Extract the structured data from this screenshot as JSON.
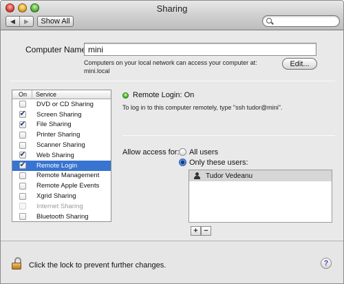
{
  "window": {
    "title": "Sharing"
  },
  "toolbar": {
    "back": "◀",
    "forward": "▶",
    "show_all": "Show All",
    "search_placeholder": ""
  },
  "computer_name": {
    "label": "Computer Name:",
    "value": "mini",
    "description_line1": "Computers on your local network can access your computer at:",
    "description_line2": "mini.local",
    "edit_button": "Edit..."
  },
  "services": {
    "header_on": "On",
    "header_service": "Service",
    "items": [
      {
        "name": "DVD or CD Sharing",
        "on": false,
        "selected": false,
        "disabled": false
      },
      {
        "name": "Screen Sharing",
        "on": true,
        "selected": false,
        "disabled": false
      },
      {
        "name": "File Sharing",
        "on": true,
        "selected": false,
        "disabled": false
      },
      {
        "name": "Printer Sharing",
        "on": false,
        "selected": false,
        "disabled": false
      },
      {
        "name": "Scanner Sharing",
        "on": false,
        "selected": false,
        "disabled": false
      },
      {
        "name": "Web Sharing",
        "on": true,
        "selected": false,
        "disabled": false
      },
      {
        "name": "Remote Login",
        "on": true,
        "selected": true,
        "disabled": false
      },
      {
        "name": "Remote Management",
        "on": false,
        "selected": false,
        "disabled": false
      },
      {
        "name": "Remote Apple Events",
        "on": false,
        "selected": false,
        "disabled": false
      },
      {
        "name": "Xgrid Sharing",
        "on": false,
        "selected": false,
        "disabled": false
      },
      {
        "name": "Internet Sharing",
        "on": false,
        "selected": false,
        "disabled": true
      },
      {
        "name": "Bluetooth Sharing",
        "on": false,
        "selected": false,
        "disabled": false
      }
    ]
  },
  "detail": {
    "status": "Remote Login: On",
    "status_color": "#49b52c",
    "info": "To log in to this computer remotely, type \"ssh tudor@mini\".",
    "allow_label": "Allow access for:",
    "option_all": "All users",
    "option_only": "Only these users:",
    "selected_option": "only",
    "users": [
      "Tudor Vedeanu"
    ],
    "add": "+",
    "remove": "−"
  },
  "footer": {
    "lock_text": "Click the lock to prevent further changes.",
    "help": "?"
  },
  "colors": {
    "selection": "#3874d1",
    "user_row": "#d6d6d6"
  }
}
